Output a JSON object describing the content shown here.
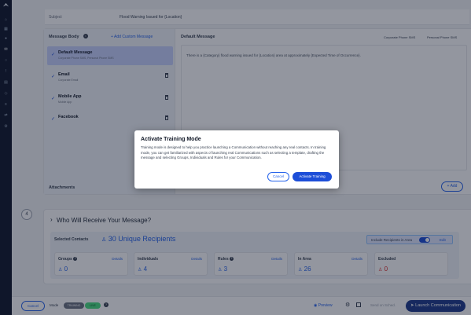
{
  "subject": {
    "label": "Subject",
    "value": "Flood Warning Issued for {Location}"
  },
  "message_body": {
    "header": "Message Body",
    "info_icon": "info-icon",
    "add_custom_label": "+ Add Custom Message",
    "channels": [
      {
        "name": "Default Message",
        "sub": "Corporate Phone SMS, Personal Phone SMS",
        "selected": true
      },
      {
        "name": "Email",
        "sub": "Corporate Email",
        "selected": false
      },
      {
        "name": "Mobile App",
        "sub": "Mobile App",
        "selected": false
      },
      {
        "name": "Facebook",
        "sub": "",
        "selected": false
      }
    ]
  },
  "default_message": {
    "header": "Default Message",
    "tabs": [
      "Corporate Phone SMS",
      "Personal Phone SMS"
    ],
    "text": "There is a {Category} flood warning issued for {Location} area at approximately {Expected Time of Occurrence}."
  },
  "attachments": {
    "label": "Attachments",
    "add_label": "+ Add"
  },
  "step": {
    "number": "4"
  },
  "who": {
    "title": "Who Will Receive Your Message?",
    "selected_contacts_label": "Selected Contacts",
    "unique_recipients": "30 Unique Recipients",
    "include_area_label": "Include Recipients in Area",
    "include_area_on": true,
    "edit_label": "Edit",
    "stats": [
      {
        "title": "Groups",
        "has_info": true,
        "details": "Details",
        "value": "0",
        "color": "blue"
      },
      {
        "title": "Individuals",
        "has_info": false,
        "details": "Details",
        "value": "4",
        "color": "blue"
      },
      {
        "title": "Rules",
        "has_info": true,
        "details": "Details",
        "value": "3",
        "color": "blue"
      },
      {
        "title": "In Area",
        "has_info": false,
        "details": "Details",
        "value": "26",
        "color": "blue"
      },
      {
        "title": "Excluded",
        "has_info": false,
        "details": "",
        "value": "0",
        "color": "red"
      }
    ]
  },
  "footer": {
    "cancel_label": "Cancel",
    "mode_label": "Mode",
    "training_label": "TRAINING",
    "live_label": "LIVE",
    "preview_label": "Preview",
    "schedule_label": "Send on Sched.",
    "launch_label": "Launch Communication"
  },
  "modal": {
    "title": "Activate Training Mode",
    "body": "Training mode is designed to help you practice launching a Communication without reaching any real contacts. In training mode, you can get familiarized with aspects of launching real Communications such as selecting a template, drafting the message and selecting Groups, Individuals and Rules for your Communication.",
    "cancel_label": "Cancel",
    "activate_label": "Activate Training"
  },
  "colors": {
    "accent": "#2563eb",
    "rail": "#0f172a",
    "launch": "#1e3a8a",
    "excluded": "#dc2626"
  }
}
